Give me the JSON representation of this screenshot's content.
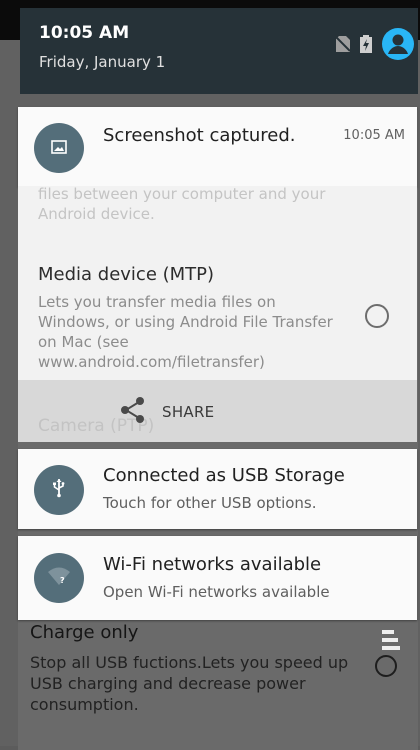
{
  "status": {
    "time": "10:05 AM",
    "date": "Friday, January 1"
  },
  "screenshot_notification": {
    "title": "Screenshot captured.",
    "time": "10:05 AM",
    "partial_text": "files between your computer and your Android device.",
    "mtp_title": "Media device (MTP)",
    "mtp_desc": "Lets you transfer media files on Windows, or using Android File Transfer on Mac (see www.android.com/filetransfer)",
    "camera_ghost": "Camera (PTP)",
    "share_label": "SHARE"
  },
  "usb_notification": {
    "title": "Connected as USB Storage",
    "subtitle": "Touch for other USB options."
  },
  "wifi_notification": {
    "title": "Wi-Fi networks available",
    "subtitle": "Open Wi-Fi networks available"
  },
  "background": {
    "option_title": "Charge only",
    "option_desc": "Stop all USB fuctions.Lets you speed up USB charging and decrease power consumption."
  },
  "colors": {
    "accent": "#29b6f6",
    "header_bg": "#263238",
    "icon_bg": "#546e7a"
  }
}
